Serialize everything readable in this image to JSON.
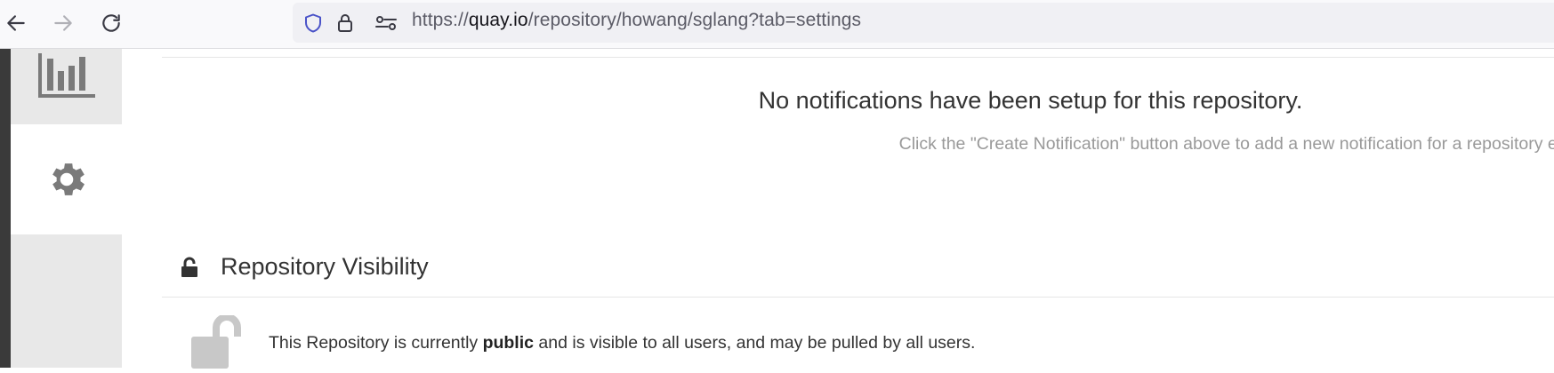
{
  "browser": {
    "url": {
      "scheme": "https://",
      "host": "quay.io",
      "path": "/repository/howang/sglang?tab=settings"
    }
  },
  "sidebar": {
    "items": [
      {
        "icon": "bar-chart-icon"
      },
      {
        "icon": "gear-icon",
        "active": true
      },
      {
        "icon": ""
      }
    ]
  },
  "notifications": {
    "empty_title": "No notifications have been setup for this repository.",
    "empty_hint": "Click the \"Create Notification\" button above to add a new notification for a repository event."
  },
  "visibility": {
    "title": "Repository Visibility",
    "text_before": "This Repository is currently ",
    "status": "public",
    "text_after": " and is visible to all users, and may be pulled by all users."
  },
  "colors": {
    "sidebar_bg": "#e8e8e8",
    "icon_gray": "#7a7a7a",
    "text_dark": "#333333",
    "text_muted": "#999999",
    "shield_blue": "#4a53c8"
  }
}
